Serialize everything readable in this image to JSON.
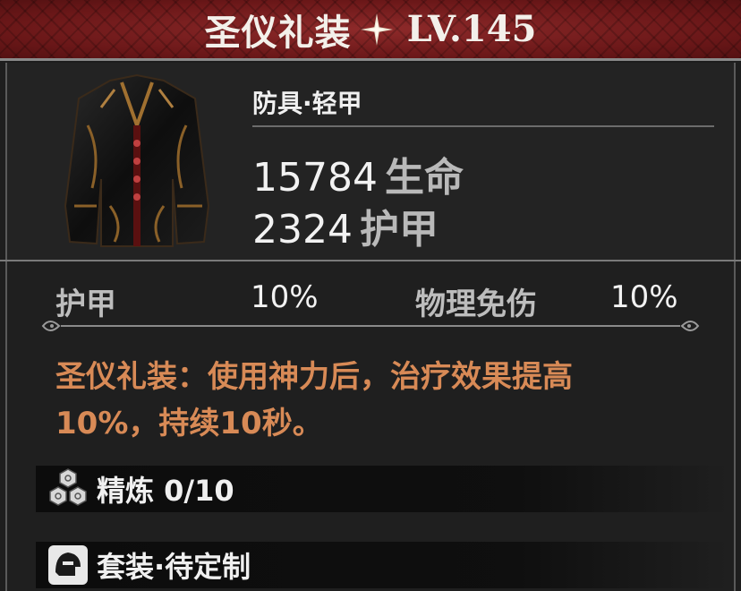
{
  "header": {
    "title": "圣仪礼装",
    "level": "LV.145"
  },
  "item": {
    "category": "防具·轻甲",
    "stats": [
      {
        "value": "15784",
        "unit": "生命"
      },
      {
        "value": "2324",
        "unit": "护甲"
      }
    ]
  },
  "substats": [
    {
      "label": "护甲",
      "value": "10%"
    },
    {
      "label": "物理免伤",
      "value": "10%"
    }
  ],
  "effect": {
    "line1": "圣仪礼装：使用神力后，治疗效果提高",
    "line2": "10%，持续10秒。"
  },
  "refine": {
    "label": "精炼 0/10",
    "icon": "hexagon-cluster-icon"
  },
  "set": {
    "label": "套装·待定制",
    "icon": "helmet-icon"
  },
  "colors": {
    "header_red": "#6e1a1c",
    "effect_orange": "#d88a56",
    "stat_unit_gray": "#b9b9b9"
  }
}
